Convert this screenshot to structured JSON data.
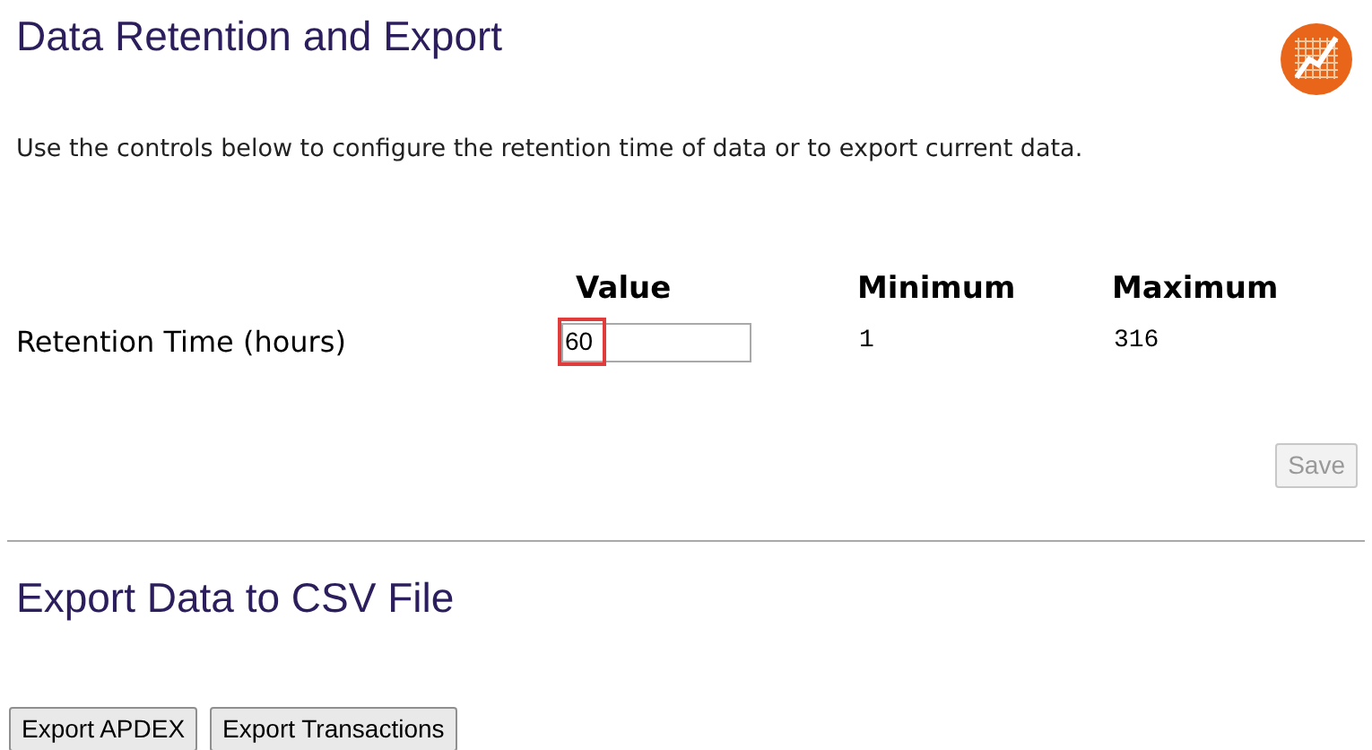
{
  "title": "Data Retention and Export",
  "description": "Use the controls below to configure the retention time of data or to export current data.",
  "settings_table": {
    "columns": [
      "Value",
      "Minimum",
      "Maximum"
    ],
    "rows": [
      {
        "label": "Retention Time (hours)",
        "value": "60",
        "highlighted": true,
        "minimum": "1",
        "maximum": "316"
      }
    ]
  },
  "save_button": {
    "label": "Save",
    "disabled": true
  },
  "export_section": {
    "title": "Export Data to CSV File",
    "buttons": [
      {
        "label": "Export APDEX",
        "disabled": false
      },
      {
        "label": "Export Transactions",
        "disabled": false
      }
    ]
  }
}
